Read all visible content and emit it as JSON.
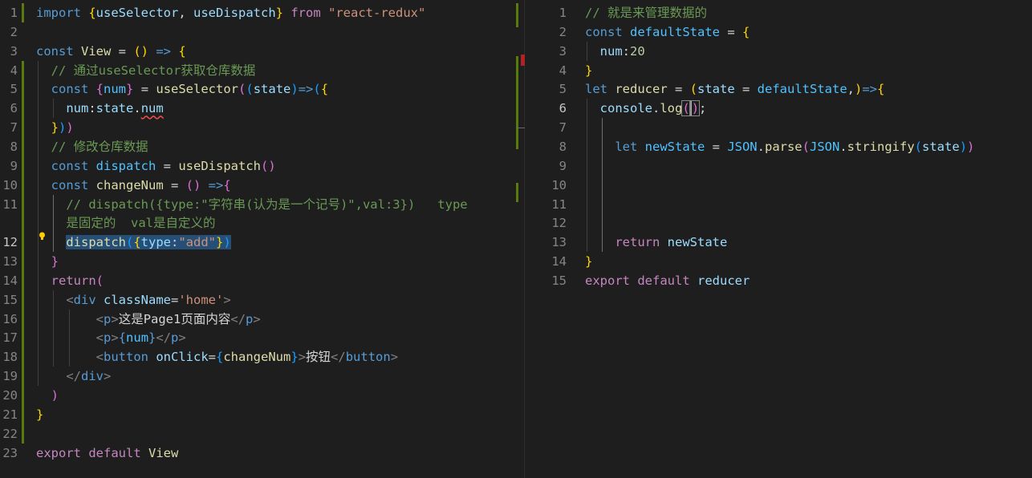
{
  "left_editor": {
    "lines": [
      {
        "num": "1",
        "tokens": [
          [
            "k",
            "import "
          ],
          [
            "b1",
            "{"
          ],
          [
            "v",
            "useSelector"
          ],
          [
            "w",
            ", "
          ],
          [
            "v",
            "useDispatch"
          ],
          [
            "b1",
            "}"
          ],
          [
            "ctl",
            " from "
          ],
          [
            "s",
            "\"react-redux\""
          ]
        ]
      },
      {
        "num": "2",
        "tokens": []
      },
      {
        "num": "3",
        "tokens": [
          [
            "k",
            "const "
          ],
          [
            "f",
            "View"
          ],
          [
            "w",
            " = "
          ],
          [
            "b1",
            "()"
          ],
          [
            "k",
            " => "
          ],
          [
            "b1",
            "{"
          ]
        ]
      },
      {
        "num": "4",
        "tokens": [
          [
            "w",
            "  "
          ],
          [
            "c",
            "// 通过useSelector获取仓库数据"
          ]
        ]
      },
      {
        "num": "5",
        "tokens": [
          [
            "w",
            "  "
          ],
          [
            "k",
            "const "
          ],
          [
            "b2",
            "{"
          ],
          [
            "cst",
            "num"
          ],
          [
            "b2",
            "}"
          ],
          [
            "w",
            " = "
          ],
          [
            "f",
            "useSelector"
          ],
          [
            "b2",
            "("
          ],
          [
            "b3",
            "("
          ],
          [
            "v",
            "state"
          ],
          [
            "b3",
            ")"
          ],
          [
            "k",
            "=>"
          ],
          [
            "b3",
            "("
          ],
          [
            "b1",
            "{"
          ]
        ]
      },
      {
        "num": "6",
        "tokens": [
          [
            "w",
            "    "
          ],
          [
            "v",
            "num"
          ],
          [
            "w",
            ":"
          ],
          [
            "v",
            "state"
          ],
          [
            "w",
            "."
          ],
          [
            "v squig",
            "num"
          ]
        ]
      },
      {
        "num": "7",
        "tokens": [
          [
            "w",
            "  "
          ],
          [
            "b1",
            "}"
          ],
          [
            "b3",
            ")"
          ],
          [
            "b2",
            ")"
          ]
        ]
      },
      {
        "num": "8",
        "tokens": [
          [
            "w",
            "  "
          ],
          [
            "c",
            "// 修改仓库数据"
          ]
        ]
      },
      {
        "num": "9",
        "tokens": [
          [
            "w",
            "  "
          ],
          [
            "k",
            "const "
          ],
          [
            "cst",
            "dispatch"
          ],
          [
            "w",
            " = "
          ],
          [
            "f",
            "useDispatch"
          ],
          [
            "b2",
            "()"
          ]
        ]
      },
      {
        "num": "10",
        "tokens": [
          [
            "w",
            "  "
          ],
          [
            "k",
            "const "
          ],
          [
            "f",
            "changeNum"
          ],
          [
            "w",
            " = "
          ],
          [
            "b2",
            "()"
          ],
          [
            "k",
            " =>"
          ],
          [
            "b2",
            "{"
          ]
        ]
      },
      {
        "num": "11",
        "tokens": [
          [
            "w",
            "    "
          ],
          [
            "c",
            "// dispatch({type:\"字符串(认为是一个记号)\",val:3})   type"
          ]
        ]
      },
      {
        "num": "",
        "tokens": [
          [
            "w",
            "    "
          ],
          [
            "c",
            "是固定的  val是自定义的"
          ]
        ]
      },
      {
        "num": "12",
        "tokens": [
          [
            "w",
            "    "
          ],
          [
            "f sel",
            "dispatch"
          ],
          [
            "b3 sel",
            "("
          ],
          [
            "b1 sel",
            "{"
          ],
          [
            "v sel",
            "type"
          ],
          [
            "w sel",
            ":"
          ],
          [
            "s sel",
            "\"add\""
          ],
          [
            "b1 sel",
            "}"
          ],
          [
            "b3 sel",
            ")"
          ]
        ]
      },
      {
        "num": "13",
        "tokens": [
          [
            "w",
            "  "
          ],
          [
            "b2",
            "}"
          ]
        ]
      },
      {
        "num": "14",
        "tokens": [
          [
            "w",
            "  "
          ],
          [
            "ctl",
            "return"
          ],
          [
            "b2",
            "("
          ]
        ]
      },
      {
        "num": "15",
        "tokens": [
          [
            "w",
            "    "
          ],
          [
            "tagb",
            "<"
          ],
          [
            "k",
            "div"
          ],
          [
            "v",
            " className"
          ],
          [
            "w",
            "="
          ],
          [
            "s",
            "'home'"
          ],
          [
            "tagb",
            ">"
          ]
        ]
      },
      {
        "num": "16",
        "tokens": [
          [
            "w",
            "        "
          ],
          [
            "tagb",
            "<"
          ],
          [
            "k",
            "p"
          ],
          [
            "tagb",
            ">"
          ],
          [
            "w",
            "这是Page1页面内容"
          ],
          [
            "tagb",
            "</"
          ],
          [
            "k",
            "p"
          ],
          [
            "tagb",
            ">"
          ]
        ]
      },
      {
        "num": "17",
        "tokens": [
          [
            "w",
            "        "
          ],
          [
            "tagb",
            "<"
          ],
          [
            "k",
            "p"
          ],
          [
            "tagb",
            ">"
          ],
          [
            "k",
            "{"
          ],
          [
            "cst",
            "num"
          ],
          [
            "k",
            "}"
          ],
          [
            "tagb",
            "</"
          ],
          [
            "k",
            "p"
          ],
          [
            "tagb",
            ">"
          ]
        ]
      },
      {
        "num": "18",
        "tokens": [
          [
            "w",
            "        "
          ],
          [
            "tagb",
            "<"
          ],
          [
            "k",
            "button"
          ],
          [
            "v",
            " onClick"
          ],
          [
            "w",
            "="
          ],
          [
            "b3",
            "{"
          ],
          [
            "f",
            "changeNum"
          ],
          [
            "b3",
            "}"
          ],
          [
            "tagb",
            ">"
          ],
          [
            "w",
            "按钮"
          ],
          [
            "tagb",
            "</"
          ],
          [
            "k",
            "button"
          ],
          [
            "tagb",
            ">"
          ]
        ]
      },
      {
        "num": "19",
        "tokens": [
          [
            "w",
            "    "
          ],
          [
            "tagb",
            "</"
          ],
          [
            "k",
            "div"
          ],
          [
            "tagb",
            ">"
          ]
        ]
      },
      {
        "num": "20",
        "tokens": [
          [
            "w",
            "  "
          ],
          [
            "b2",
            ")"
          ]
        ]
      },
      {
        "num": "21",
        "tokens": [
          [
            "b1",
            "}"
          ]
        ]
      },
      {
        "num": "22",
        "tokens": []
      },
      {
        "num": "23",
        "tokens": [
          [
            "ctl",
            "export"
          ],
          [
            "ctl",
            " default "
          ],
          [
            "f",
            "View"
          ]
        ]
      }
    ]
  },
  "right_editor": {
    "lines": [
      {
        "num": "1",
        "tokens": [
          [
            "c",
            "// 就是来管理数据的"
          ]
        ]
      },
      {
        "num": "2",
        "tokens": [
          [
            "k",
            "const "
          ],
          [
            "cst",
            "defaultState"
          ],
          [
            "w",
            " = "
          ],
          [
            "b1",
            "{"
          ]
        ]
      },
      {
        "num": "3",
        "tokens": [
          [
            "w",
            "  "
          ],
          [
            "v",
            "num"
          ],
          [
            "w",
            ":"
          ],
          [
            "n",
            "20"
          ]
        ]
      },
      {
        "num": "4",
        "tokens": [
          [
            "b1",
            "}"
          ]
        ]
      },
      {
        "num": "5",
        "tokens": [
          [
            "k",
            "let "
          ],
          [
            "f",
            "reducer"
          ],
          [
            "w",
            " = "
          ],
          [
            "b1",
            "("
          ],
          [
            "v",
            "state"
          ],
          [
            "w",
            " = "
          ],
          [
            "cst",
            "defaultState"
          ],
          [
            "w",
            ","
          ],
          [
            "b1",
            ")"
          ],
          [
            "k",
            "=>"
          ],
          [
            "b1",
            "{"
          ]
        ]
      },
      {
        "num": "6",
        "tokens": [
          [
            "w",
            "  "
          ],
          [
            "v",
            "console"
          ],
          [
            "w",
            "."
          ],
          [
            "f",
            "log"
          ],
          [
            "b2 bracket-box",
            "("
          ],
          [
            "b2 cursor bracket-box",
            ")"
          ],
          [
            "w",
            ";"
          ]
        ]
      },
      {
        "num": "7",
        "tokens": []
      },
      {
        "num": "8",
        "tokens": [
          [
            "w",
            "    "
          ],
          [
            "k",
            "let "
          ],
          [
            "cst",
            "newState"
          ],
          [
            "w",
            " = "
          ],
          [
            "cst",
            "JSON"
          ],
          [
            "w",
            "."
          ],
          [
            "f",
            "parse"
          ],
          [
            "b2",
            "("
          ],
          [
            "cst",
            "JSON"
          ],
          [
            "w",
            "."
          ],
          [
            "f",
            "stringify"
          ],
          [
            "b3",
            "("
          ],
          [
            "v",
            "state"
          ],
          [
            "b3",
            ")"
          ],
          [
            "b2",
            ")"
          ]
        ]
      },
      {
        "num": "9",
        "tokens": []
      },
      {
        "num": "10",
        "tokens": []
      },
      {
        "num": "11",
        "tokens": []
      },
      {
        "num": "12",
        "tokens": []
      },
      {
        "num": "13",
        "tokens": [
          [
            "w",
            "    "
          ],
          [
            "ctl",
            "return "
          ],
          [
            "v",
            "newState"
          ]
        ]
      },
      {
        "num": "14",
        "tokens": [
          [
            "b1",
            "}"
          ]
        ]
      },
      {
        "num": "15",
        "tokens": [
          [
            "ctl",
            "export"
          ],
          [
            "ctl",
            " default "
          ],
          [
            "v",
            "reducer"
          ]
        ]
      }
    ],
    "active_line": "6"
  },
  "left_active_line": "12",
  "lightbulb_icon": "lightbulb-icon",
  "colors": {
    "background": "#1e1e1e",
    "keyword": "#569cd6",
    "comment": "#6a9955",
    "string": "#ce9178",
    "variable": "#9cdcfe",
    "function": "#dcdcaa",
    "selection": "#264f78",
    "git_added": "#587c0c"
  }
}
